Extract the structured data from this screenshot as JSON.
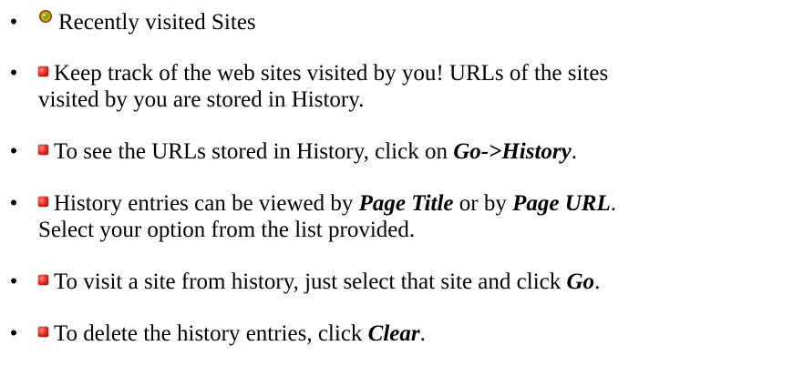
{
  "list": {
    "bullet_char": "•",
    "items": [
      {
        "icon": "globe-icon",
        "text": "Recently visited Sites"
      },
      {
        "icon": "red-square-icon",
        "line1": "Keep track of the web sites visited by you! URLs of the sites",
        "line2": "visited by you are stored in History."
      },
      {
        "icon": "red-square-icon",
        "text_before": "To see the URLs stored in History, click on ",
        "emphasis": "Go->History",
        "text_after": "."
      },
      {
        "icon": "red-square-icon",
        "text_before": "History entries can be viewed by ",
        "emphasis1": "Page Title",
        "text_middle": " or by ",
        "emphasis2": "Page URL",
        "text_after": ".",
        "line2": "Select your option from the list provided."
      },
      {
        "icon": "red-square-icon",
        "text_before": "To visit a site from history, just select that site and click ",
        "emphasis": "Go",
        "text_after": "."
      },
      {
        "icon": "red-square-icon",
        "text_before": "To delete the history entries, click ",
        "emphasis": "Clear",
        "text_after": "."
      }
    ]
  },
  "colors": {
    "text": "#000000",
    "background": "#ffffff",
    "icon_red": "#e0201b",
    "globe_dark": "#6b4a12",
    "globe_light": "#d9a400"
  }
}
